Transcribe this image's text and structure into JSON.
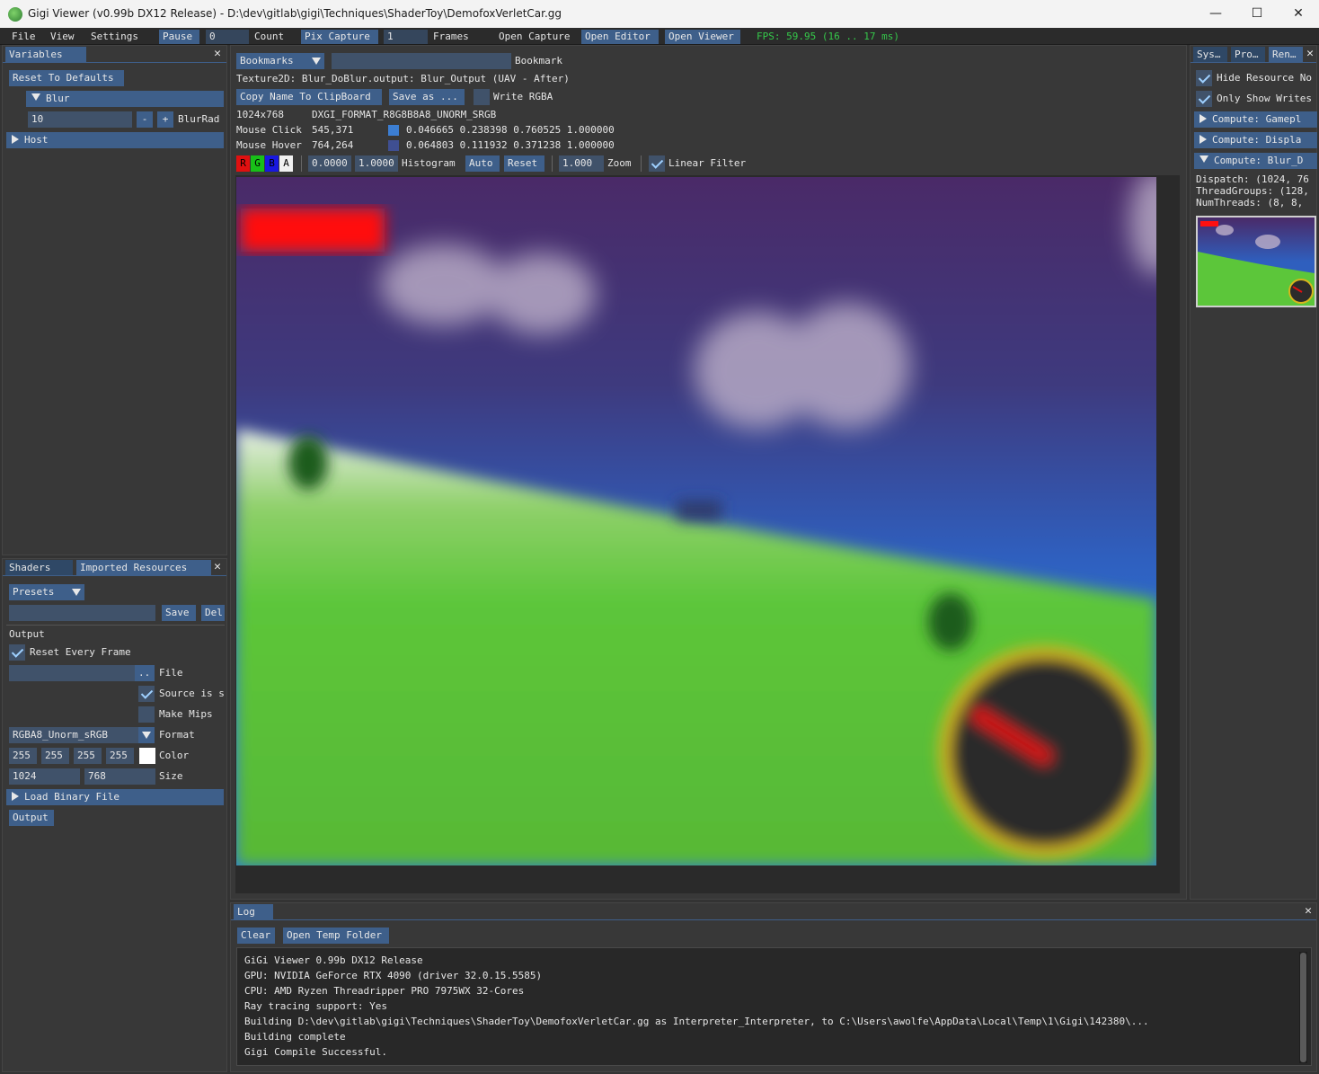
{
  "window": {
    "title": "Gigi Viewer (v0.99b DX12 Release) - D:\\dev\\gitlab\\gigi\\Techniques\\ShaderToy\\DemofoxVerletCar.gg",
    "minimize": "—",
    "maximize": "☐",
    "close": "✕"
  },
  "menubar": {
    "file": "File",
    "view": "View",
    "settings": "Settings",
    "pause": "Pause",
    "count_value": "0",
    "count_label": "Count",
    "pix_capture": "Pix Capture",
    "frames_value": "1",
    "frames_label": "Frames",
    "open_capture": "Open Capture",
    "open_editor": "Open Editor",
    "open_viewer": "Open Viewer",
    "fps": "FPS: 59.95 (16 .. 17 ms)"
  },
  "variables": {
    "tab": "Variables",
    "reset_defaults": "Reset To Defaults",
    "blur_header": "Blur",
    "blur_radius_value": "10",
    "minus": "-",
    "plus": "+",
    "blur_radius_label": "BlurRad",
    "host_header": "Host"
  },
  "shaders_panel": {
    "tab_shaders": "Shaders",
    "tab_imported": "Imported Resources",
    "presets": "Presets",
    "save": "Save",
    "del": "Del",
    "output_label": "Output",
    "reset_every_frame": "Reset Every Frame",
    "browse": "..",
    "file_label": "File",
    "source_is": "Source is s",
    "make_mips": "Make Mips",
    "format_value": "RGBA8_Unorm_sRGB",
    "format_label": "Format",
    "color_r": "255",
    "color_g": "255",
    "color_b": "255",
    "color_a": "255",
    "color_label": "Color",
    "size_w": "1024",
    "size_h": "768",
    "size_label": "Size",
    "load_binary": "Load Binary File",
    "output_button": "Output"
  },
  "viewer": {
    "bookmarks": "Bookmarks",
    "bookmark_label": "Bookmark",
    "texture_info": "Texture2D: Blur_DoBlur.output: Blur_Output (UAV - After)",
    "copy_name": "Copy Name To ClipBoard",
    "save_as": "Save as ...",
    "write_rgba": "Write RGBA",
    "dims": "1024x768",
    "format": "DXGI_FORMAT_R8G8B8A8_UNORM_SRGB",
    "mouse_click_label": "Mouse Click",
    "mouse_click_pos": "545,371",
    "mouse_click_value": "0.046665 0.238398 0.760525 1.000000",
    "mouse_click_color": "#3c7ed2",
    "mouse_hover_label": "Mouse Hover",
    "mouse_hover_pos": "764,264",
    "mouse_hover_value": "0.064803 0.111932 0.371238 1.000000",
    "mouse_hover_color": "#3f4f92",
    "ch_r": "R",
    "ch_g": "G",
    "ch_b": "B",
    "ch_a": "A",
    "range_min": "0.0000",
    "range_max": "1.0000",
    "histogram": "Histogram",
    "auto": "Auto",
    "reset": "Reset",
    "zoom_value": "1.000",
    "zoom_label": "Zoom",
    "linear_filter": "Linear Filter"
  },
  "render_panel": {
    "tab_sys": "Sys…",
    "tab_pro": "Pro…",
    "tab_ren": "Ren…",
    "hide_resource": "Hide Resource No",
    "only_show_writes": "Only Show Writes",
    "compute_gameplay": "Compute: Gamepl",
    "compute_display": "Compute: Displa",
    "compute_blur": "Compute: Blur_D",
    "dispatch": "Dispatch: (1024, 76",
    "thread_groups": "ThreadGroups: (128,",
    "num_threads": "NumThreads: (8, 8,"
  },
  "log": {
    "tab": "Log",
    "clear": "Clear",
    "open_temp": "Open Temp Folder",
    "lines": [
      "GiGi Viewer 0.99b DX12 Release",
      "GPU: NVIDIA GeForce RTX 4090 (driver 32.0.15.5585)",
      "CPU: AMD Ryzen Threadripper PRO 7975WX 32-Cores",
      "Ray tracing support: Yes",
      "Building D:\\dev\\gitlab\\gigi\\Techniques\\ShaderToy\\DemofoxVerletCar.gg as Interpreter_Interpreter, to C:\\Users\\awolfe\\AppData\\Local\\Temp\\1\\Gigi\\142380\\...",
      "Building complete",
      "Gigi Compile Successful."
    ]
  },
  "colors": {
    "accent": "#3e5f8a",
    "panel_bg": "#383838",
    "fps_green": "#35c84a",
    "sky_top": "#4a2a68",
    "sky_bottom": "#2d6fd6",
    "ground": "#5cc63a"
  },
  "icons": {
    "app": "gigi-logo-icon",
    "checkbox": "checkmark-icon",
    "dropdown": "chevron-down-icon",
    "tree_collapsed": "triangle-right-icon",
    "tree_expanded": "triangle-down-icon",
    "close": "close-icon"
  }
}
